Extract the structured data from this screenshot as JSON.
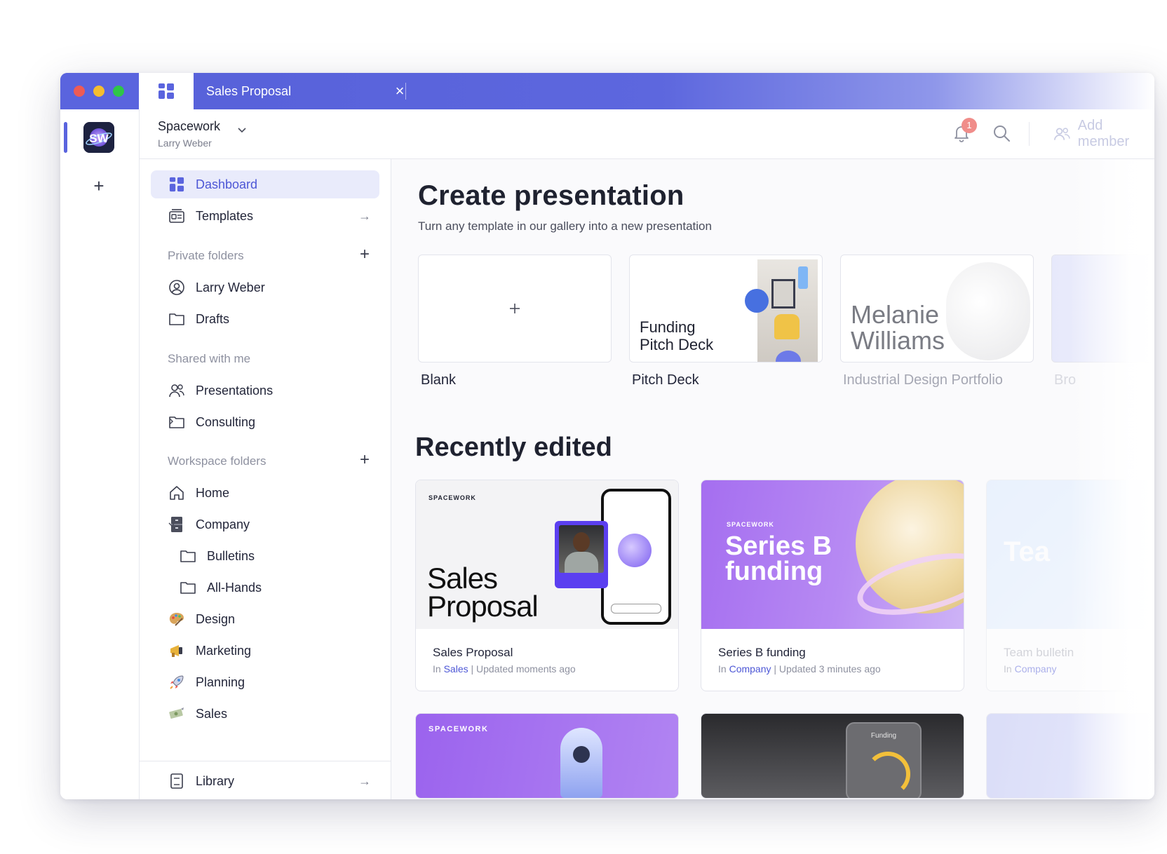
{
  "titlebar": {
    "tab_title": "Sales Proposal",
    "close_glyph": "×"
  },
  "rail": {
    "logo_text": "SW",
    "add_glyph": "+"
  },
  "header": {
    "workspace_name": "Spacework",
    "workspace_user": "Larry Weber",
    "notification_count": "1",
    "add_member_label": "Add member"
  },
  "sidebar": {
    "dashboard": "Dashboard",
    "templates": "Templates",
    "private_folders": "Private folders",
    "larry_weber": "Larry Weber",
    "drafts": "Drafts",
    "shared_with_me": "Shared with me",
    "presentations": "Presentations",
    "consulting": "Consulting",
    "workspace_folders": "Workspace folders",
    "home": "Home",
    "company": "Company",
    "bulletins": "Bulletins",
    "all_hands": "All-Hands",
    "design": "Design",
    "marketing": "Marketing",
    "planning": "Planning",
    "sales": "Sales",
    "library": "Library",
    "arrow": "→",
    "plus": "+"
  },
  "main": {
    "create_title": "Create presentation",
    "create_subtitle": "Turn any template in our gallery into a new presentation",
    "templates": [
      {
        "label": "Blank"
      },
      {
        "label": "Pitch Deck",
        "thumb_text_1": "Funding",
        "thumb_text_2": "Pitch Deck"
      },
      {
        "label": "Industrial Design Portfolio",
        "thumb_text_1": "Melanie",
        "thumb_text_2": "Williams"
      },
      {
        "label": "Bro"
      }
    ],
    "recent_title": "Recently edited",
    "recent": [
      {
        "title": "Sales Proposal",
        "in_prefix": "In",
        "folder": "Sales",
        "updated": "| Updated moments ago",
        "thumb_brand": "SPACEWORK",
        "thumb_line1": "Sales",
        "thumb_line2": "Proposal"
      },
      {
        "title": "Series B funding",
        "in_prefix": "In",
        "folder": "Company",
        "updated": "| Updated 3 minutes ago",
        "thumb_brand": "SPACEWORK",
        "thumb_line1": "Series B",
        "thumb_line2": "funding"
      },
      {
        "title": "Team bulletin",
        "in_prefix": "In",
        "folder": "Company",
        "updated": "",
        "thumb_text": "Tea"
      }
    ],
    "bottom": [
      {
        "brand": "SPACEWORK"
      },
      {
        "label": "Funding"
      }
    ]
  },
  "colors": {
    "accent": "#5a64de",
    "active_bg": "#e9ebfb",
    "series_b_purple": "#a96ff0"
  }
}
